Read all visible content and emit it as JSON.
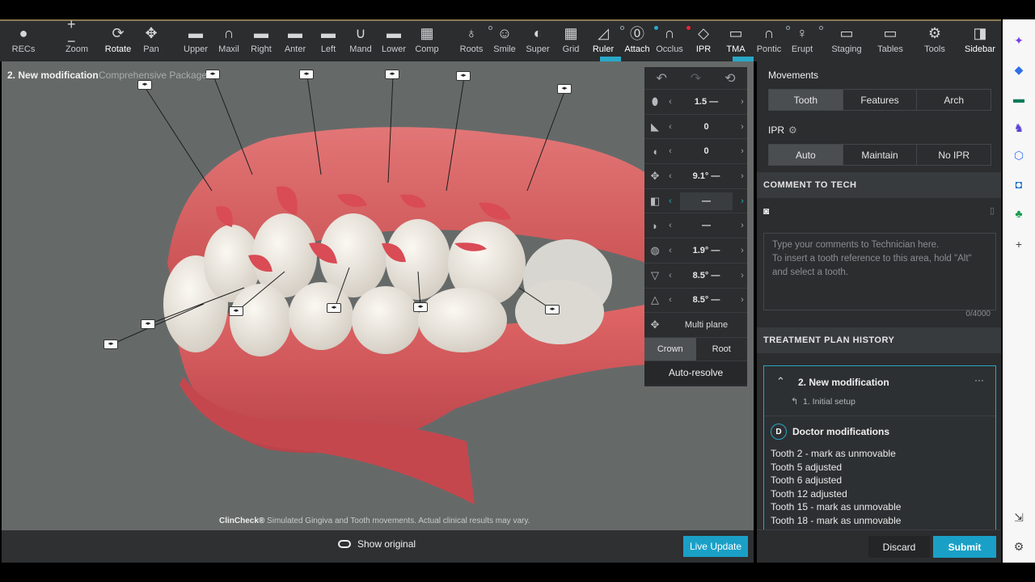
{
  "toolbar": {
    "items": [
      {
        "label": "RECs",
        "icon": "person-icon",
        "glyph": "●"
      },
      {
        "label": "Zoom",
        "icon": "zoom-icon",
        "glyph": "+ −"
      },
      {
        "label": "Rotate",
        "icon": "rotate-icon",
        "glyph": "⟳"
      },
      {
        "label": "Pan",
        "icon": "pan-icon",
        "glyph": "✥"
      },
      {
        "label": "Upper",
        "icon": "upper-icon",
        "glyph": "▬"
      },
      {
        "label": "Maxil",
        "icon": "maxil-icon",
        "glyph": "∩"
      },
      {
        "label": "Right",
        "icon": "right-icon",
        "glyph": "▬"
      },
      {
        "label": "Anter",
        "icon": "anter-icon",
        "glyph": "▬"
      },
      {
        "label": "Left",
        "icon": "left-icon",
        "glyph": "▬"
      },
      {
        "label": "Mand",
        "icon": "mand-icon",
        "glyph": "∪"
      },
      {
        "label": "Lower",
        "icon": "lower-icon",
        "glyph": "▬"
      },
      {
        "label": "Comp",
        "icon": "comp-icon",
        "glyph": "▦"
      },
      {
        "label": "Roots",
        "icon": "roots-icon",
        "glyph": "♁"
      },
      {
        "label": "Smile",
        "icon": "smile-icon",
        "glyph": "☺"
      },
      {
        "label": "Super",
        "icon": "super-icon",
        "glyph": "◐"
      },
      {
        "label": "Grid",
        "icon": "grid-icon",
        "glyph": "▦"
      },
      {
        "label": "Ruler",
        "icon": "ruler-icon",
        "glyph": "◿"
      },
      {
        "label": "Attach",
        "icon": "attach-icon",
        "glyph": "⓪"
      },
      {
        "label": "Occlus",
        "icon": "occlus-icon",
        "glyph": "∩"
      },
      {
        "label": "IPR",
        "icon": "ipr-icon",
        "glyph": "◇"
      },
      {
        "label": "TMA",
        "icon": "tma-icon",
        "glyph": "▭"
      },
      {
        "label": "Pontic",
        "icon": "pontic-icon",
        "glyph": "∩"
      },
      {
        "label": "Erupt",
        "icon": "erupt-icon",
        "glyph": "♀"
      },
      {
        "label": "Staging",
        "icon": "staging-icon",
        "glyph": "▭"
      },
      {
        "label": "Tables",
        "icon": "tables-icon",
        "glyph": "▭"
      },
      {
        "label": "Tools",
        "icon": "tools-icon",
        "glyph": "⚙"
      },
      {
        "label": "Sidebar",
        "icon": "sidebar-icon",
        "glyph": "◨"
      }
    ]
  },
  "viewport": {
    "title": "2. New modification",
    "package": "Comprehensive Package",
    "disclaimer_brand": "ClinCheck®",
    "disclaimer": " Simulated Gingiva and Tooth movements. Actual clinical results may vary.",
    "show_original": "Show original",
    "live_update": "Live Update"
  },
  "movement_panel": {
    "rows": [
      {
        "value": "1.5 —",
        "icon": "extrusion-icon"
      },
      {
        "value": "0",
        "icon": "mesial-icon"
      },
      {
        "value": "0",
        "icon": "buccal-icon"
      },
      {
        "value": "9.1° —",
        "icon": "rotation-icon"
      },
      {
        "value": "—",
        "icon": "angulation-icon"
      },
      {
        "value": "—",
        "icon": "inclination-icon"
      },
      {
        "value": "1.9° —",
        "icon": "torque-icon"
      },
      {
        "value": "8.5° —",
        "icon": "tip-icon"
      },
      {
        "value": "8.5° —",
        "icon": "crown-tip-icon"
      }
    ],
    "multi_plane": "Multi plane",
    "crown": "Crown",
    "root": "Root",
    "auto_resolve": "Auto-resolve"
  },
  "sidebar": {
    "movements_label": "Movements",
    "movements_tabs": [
      "Tooth",
      "Features",
      "Arch"
    ],
    "ipr_label": "IPR",
    "ipr_tabs": [
      "Auto",
      "Maintain",
      "No IPR"
    ],
    "comment_header": "COMMENT TO TECH",
    "comment_placeholder_1": "Type your comments to Technician here.",
    "comment_placeholder_2": "To insert a tooth reference to this area, hold \"Alt\"",
    "comment_placeholder_3": "and select a tooth.",
    "comment_count": "0/4000",
    "history_header": "TREATMENT PLAN HISTORY",
    "history_title": "2. New modification",
    "history_sub": "1. Initial setup",
    "doctor_badge": "D",
    "doctor_mods": "Doctor modifications",
    "mods": [
      "Tooth 2 - mark as unmovable",
      "Tooth 5 adjusted",
      "Tooth 6 adjusted",
      "Tooth 12 adjusted",
      "Tooth 15 - mark as unmovable",
      "Tooth 18 - mark as unmovable"
    ],
    "discard": "Discard",
    "submit": "Submit"
  },
  "colors": {
    "accent": "#1aa0c7",
    "gum": "#d9605e",
    "tooth": "#e9e4db",
    "attachment": "#d94b55"
  }
}
